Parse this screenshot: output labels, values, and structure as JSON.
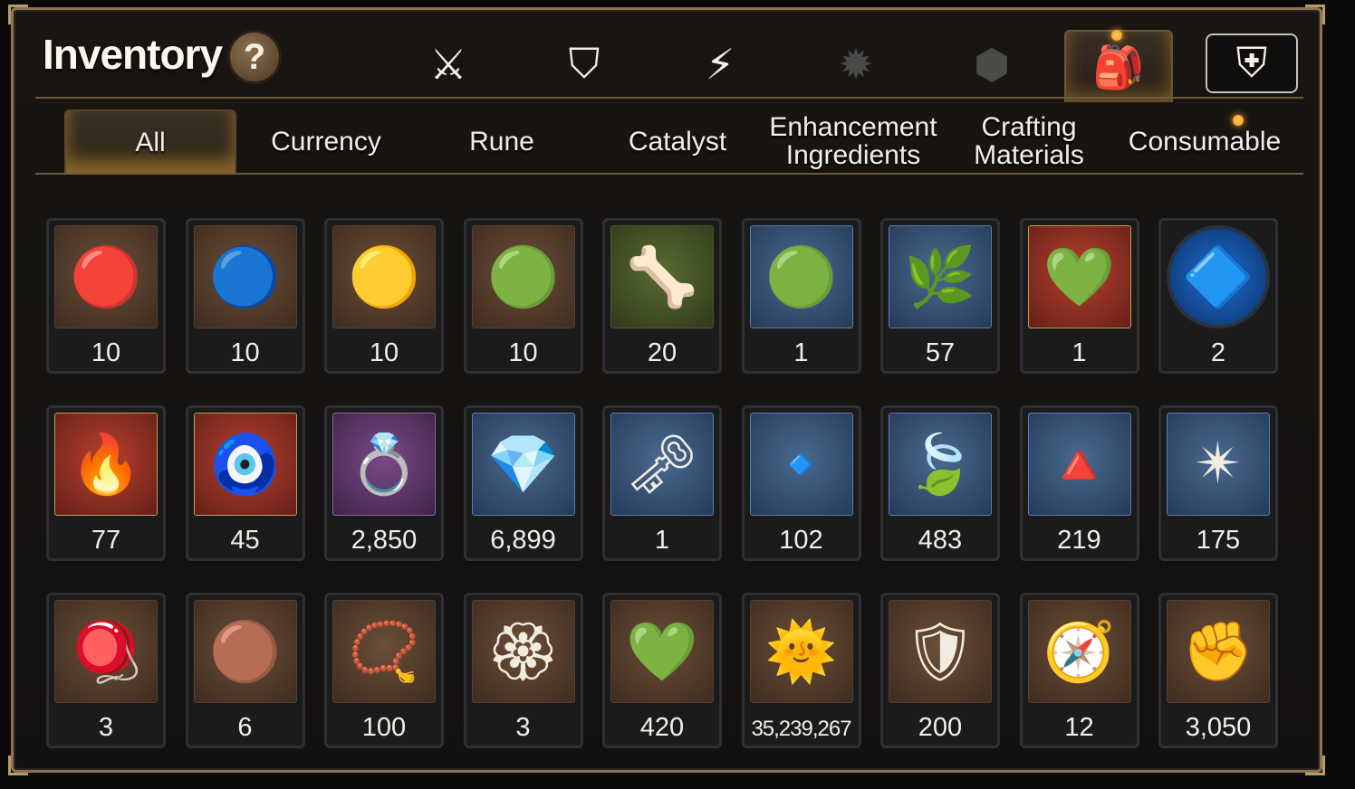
{
  "header": {
    "title": "Inventory",
    "help_label": "?"
  },
  "icon_tabs": [
    {
      "icon": "sword-shield-icon",
      "glyph": "⚔",
      "state": "normal"
    },
    {
      "icon": "broken-shield-icon",
      "glyph": "⛉",
      "state": "normal"
    },
    {
      "icon": "lightning-icon",
      "glyph": "⚡",
      "state": "normal"
    },
    {
      "icon": "burst-emblem-icon",
      "glyph": "✹",
      "state": "dim"
    },
    {
      "icon": "cube-icon",
      "glyph": "⬢",
      "state": "dim"
    },
    {
      "icon": "backpack-icon",
      "glyph": "🎒",
      "state": "active",
      "badge": true
    },
    {
      "icon": "guild-shield-icon",
      "glyph": "⛨",
      "state": "boxed"
    }
  ],
  "category_tabs": [
    {
      "label": "All",
      "active": true
    },
    {
      "label": "Currency"
    },
    {
      "label": "Rune"
    },
    {
      "label": "Catalyst"
    },
    {
      "label": "Enhancement Ingredients",
      "lines": [
        "Enhancement",
        "Ingredients"
      ]
    },
    {
      "label": "Crafting Materials",
      "lines": [
        "Crafting",
        "Materials"
      ]
    },
    {
      "label": "Consumable",
      "badge": true
    }
  ],
  "items": [
    {
      "icon": "fire-rune-icon",
      "glyph": "🔴",
      "qty": "10",
      "frame": "brown"
    },
    {
      "icon": "ice-rune-icon",
      "glyph": "🔵",
      "qty": "10",
      "frame": "brown"
    },
    {
      "icon": "light-rune-icon",
      "glyph": "🟡",
      "qty": "10",
      "frame": "brown"
    },
    {
      "icon": "earth-rune-icon",
      "glyph": "🟢",
      "qty": "10",
      "frame": "brown"
    },
    {
      "icon": "claw-icon",
      "glyph": "🦴",
      "qty": "20",
      "frame": "green"
    },
    {
      "icon": "slime-orbs-icon",
      "glyph": "🟢",
      "qty": "1",
      "frame": "blue"
    },
    {
      "icon": "root-herb-icon",
      "glyph": "🌿",
      "qty": "57",
      "frame": "blue"
    },
    {
      "icon": "green-gem-icon",
      "glyph": "💚",
      "qty": "1",
      "frame": "red"
    },
    {
      "icon": "blue-seal-icon",
      "glyph": "🔷",
      "qty": "2",
      "frame": "round"
    },
    {
      "icon": "fire-crystal-icon",
      "glyph": "🔥",
      "qty": "77",
      "frame": "red"
    },
    {
      "icon": "pendant-icon",
      "glyph": "🧿",
      "qty": "45",
      "frame": "red"
    },
    {
      "icon": "flower-ring-icon",
      "glyph": "💍",
      "qty": "2,850",
      "frame": "purple"
    },
    {
      "icon": "blue-crystal-icon",
      "glyph": "💎",
      "qty": "6,899",
      "frame": "blue"
    },
    {
      "icon": "key-charm-icon",
      "glyph": "🗝",
      "qty": "1",
      "frame": "blue"
    },
    {
      "icon": "cyan-crystal-icon",
      "glyph": "🔹",
      "qty": "102",
      "frame": "blue"
    },
    {
      "icon": "leaf-icon",
      "glyph": "🍃",
      "qty": "483",
      "frame": "blue"
    },
    {
      "icon": "pink-ore-icon",
      "glyph": "🔺",
      "qty": "219",
      "frame": "blue"
    },
    {
      "icon": "star-amulet-icon",
      "glyph": "✴",
      "qty": "175",
      "frame": "blue"
    },
    {
      "icon": "orb-device-icon",
      "glyph": "🪀",
      "qty": "3",
      "frame": "brown"
    },
    {
      "icon": "lava-orb-icon",
      "glyph": "🟤",
      "qty": "6",
      "frame": "brown"
    },
    {
      "icon": "red-bracelet-icon",
      "glyph": "📿",
      "qty": "100",
      "frame": "brown"
    },
    {
      "icon": "red-badge-icon",
      "glyph": "🏵",
      "qty": "3",
      "frame": "brown"
    },
    {
      "icon": "green-heart-icon",
      "glyph": "💚",
      "qty": "420",
      "frame": "brown"
    },
    {
      "icon": "gold-coin-icon",
      "glyph": "🌞",
      "qty": "35,239,267",
      "frame": "brown",
      "small": true
    },
    {
      "icon": "gold-emblem-icon",
      "glyph": "🛡",
      "qty": "200",
      "frame": "brown"
    },
    {
      "icon": "compass-stone-icon",
      "glyph": "🧭",
      "qty": "12",
      "frame": "brown"
    },
    {
      "icon": "fist-badge-icon",
      "glyph": "✊",
      "qty": "3,050",
      "frame": "brown"
    }
  ]
}
